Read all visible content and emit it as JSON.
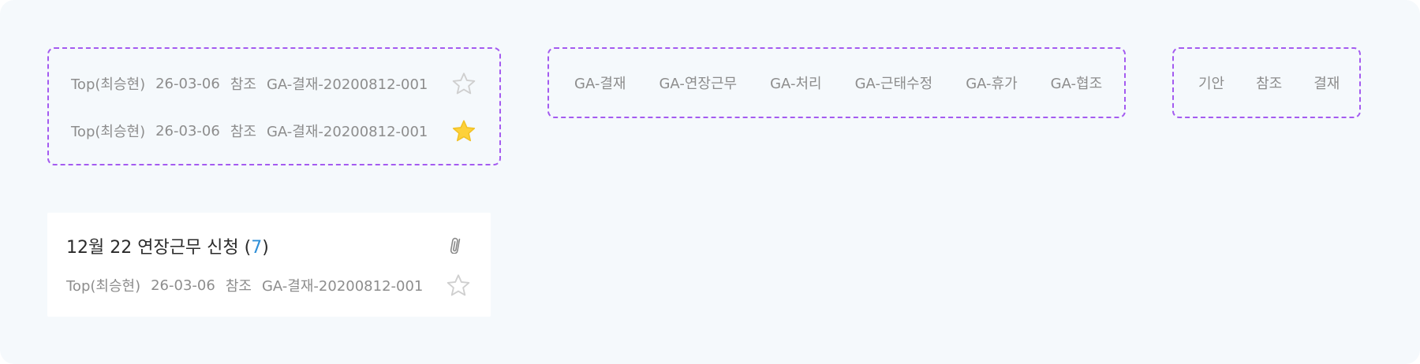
{
  "approval_rows": [
    {
      "author": "Top(최승현)",
      "date": "26-03-06",
      "type": "참조",
      "doc_no": "GA-결재-20200812-001",
      "starred": false
    },
    {
      "author": "Top(최승현)",
      "date": "26-03-06",
      "type": "참조",
      "doc_no": "GA-결재-20200812-001",
      "starred": true
    }
  ],
  "categories": [
    "GA-결재",
    "GA-연장근무",
    "GA-처리",
    "GA-근태수정",
    "GA-휴가",
    "GA-협조"
  ],
  "doc_types": [
    "기안",
    "참조",
    "결재"
  ],
  "card": {
    "title_prefix": "12월 22 연장근무 신청 (",
    "count": "7",
    "title_suffix": ")",
    "attachment_icon": "paperclip-icon",
    "author": "Top(최승현)",
    "date": "26-03-06",
    "type": "참조",
    "doc_no": "GA-결재-20200812-001",
    "starred": false
  },
  "colors": {
    "background": "#f5f9fc",
    "dashed_border": "#a45bf0",
    "meta_text": "#8d8d8d",
    "star_filled": "#fdd13a",
    "star_outline": "#cfcfcf",
    "count_accent": "#2f8fd8"
  }
}
